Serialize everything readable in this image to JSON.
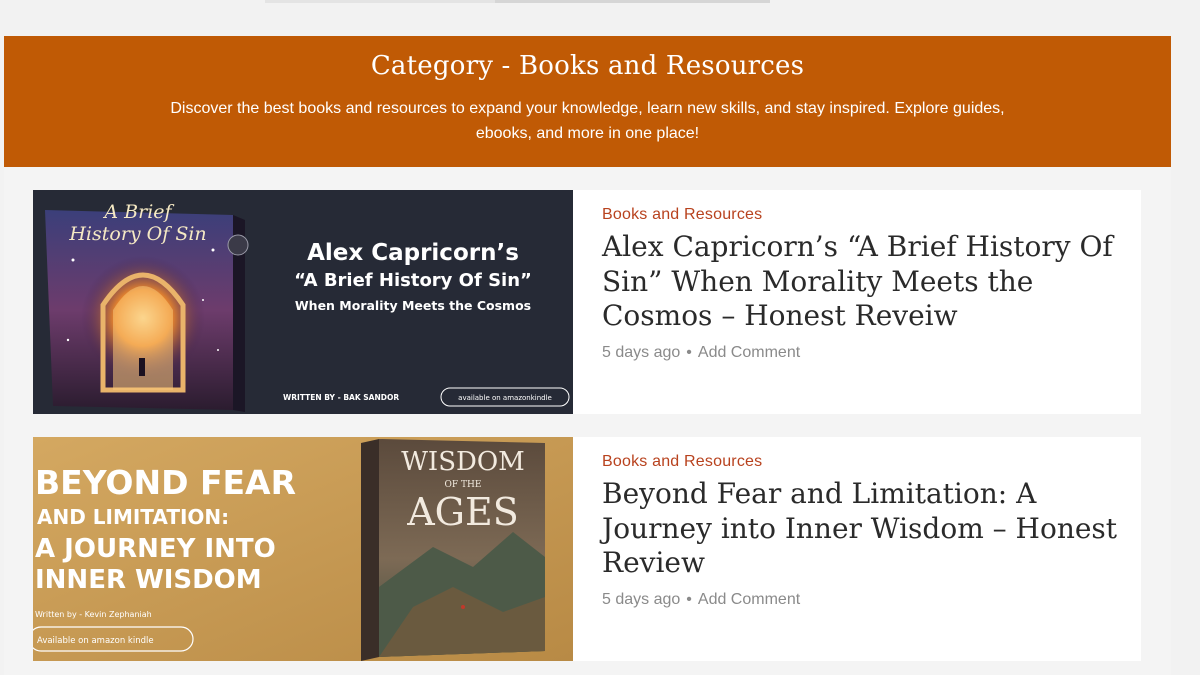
{
  "banner": {
    "title": "Category - Books and Resources",
    "description": "Discover the best books and resources to expand your knowledge, learn new skills, and stay inspired. Explore guides, ebooks, and more in one place!"
  },
  "posts": [
    {
      "category": "Books and Resources",
      "title": "Alex Capricorn’s “A Brief History Of Sin”  When Morality Meets the Cosmos – Honest Reveiw",
      "time": "5 days ago",
      "separator": "•",
      "comment": "Add Comment",
      "image": {
        "book_title_l1": "A Brief",
        "book_title_l2": "History Of Sin",
        "headline_l1": "Alex Capricorn’s",
        "headline_l2": "“A Brief History Of Sin”",
        "headline_l3": "When Morality Meets the Cosmos",
        "written_by": "WRITTEN BY - BAK SANDOR",
        "availability": "available on amazonkindle"
      }
    },
    {
      "category": "Books and Resources",
      "title": "Beyond Fear and Limitation: A Journey into Inner Wisdom – Honest Review",
      "time": "5 days ago",
      "separator": "•",
      "comment": "Add Comment",
      "image": {
        "headline_l1": "BEYOND FEAR",
        "headline_l2": "AND LIMITATION:",
        "headline_l3": "A JOURNEY INTO",
        "headline_l4": "INNER WISDOM",
        "written_by": "Written by - Kevin Zephaniah",
        "availability": "Available on amazon kindle",
        "book_title_l1": "WISDOM",
        "book_title_l2": "OF THE",
        "book_title_l3": "AGES"
      }
    }
  ],
  "colors": {
    "banner_bg": "#c05a05",
    "category_text": "#b8421e",
    "thumb1_bg": "#262a36",
    "thumb2_bg": "#c79a55"
  }
}
